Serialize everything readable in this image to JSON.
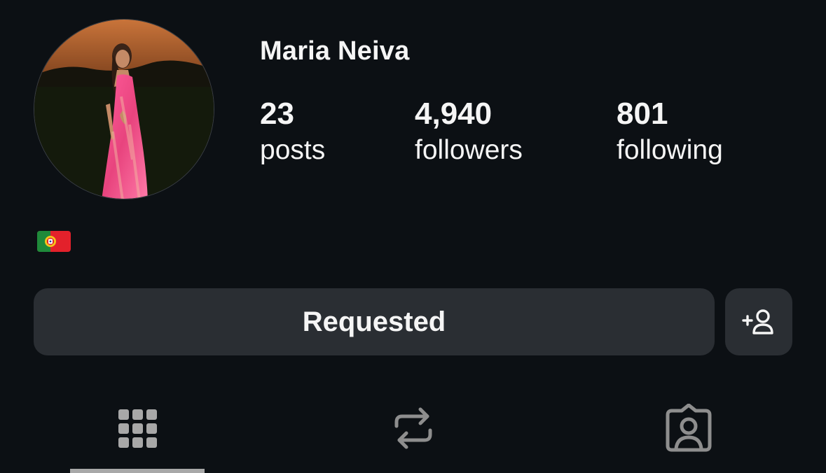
{
  "profile": {
    "username": "Maria Neiva",
    "bio": "🇵🇹",
    "bio_flag_icon": "portugal-flag-icon"
  },
  "stats": {
    "posts": {
      "value": "23",
      "label": "posts"
    },
    "followers": {
      "value": "4,940",
      "label": "followers"
    },
    "following": {
      "value": "801",
      "label": "following"
    }
  },
  "actions": {
    "requested_label": "Requested",
    "add_icon": "add-person-icon"
  },
  "tabs": [
    {
      "icon": "grid-icon",
      "active": true
    },
    {
      "icon": "repost-icon",
      "active": false
    },
    {
      "icon": "tagged-person-icon",
      "active": false
    }
  ],
  "colors": {
    "background": "#0c1014",
    "button_bg": "#2a2e33",
    "text": "#f5f5f5",
    "icon_inactive": "#8e8e8e",
    "icon_active": "#a8a8a8"
  }
}
